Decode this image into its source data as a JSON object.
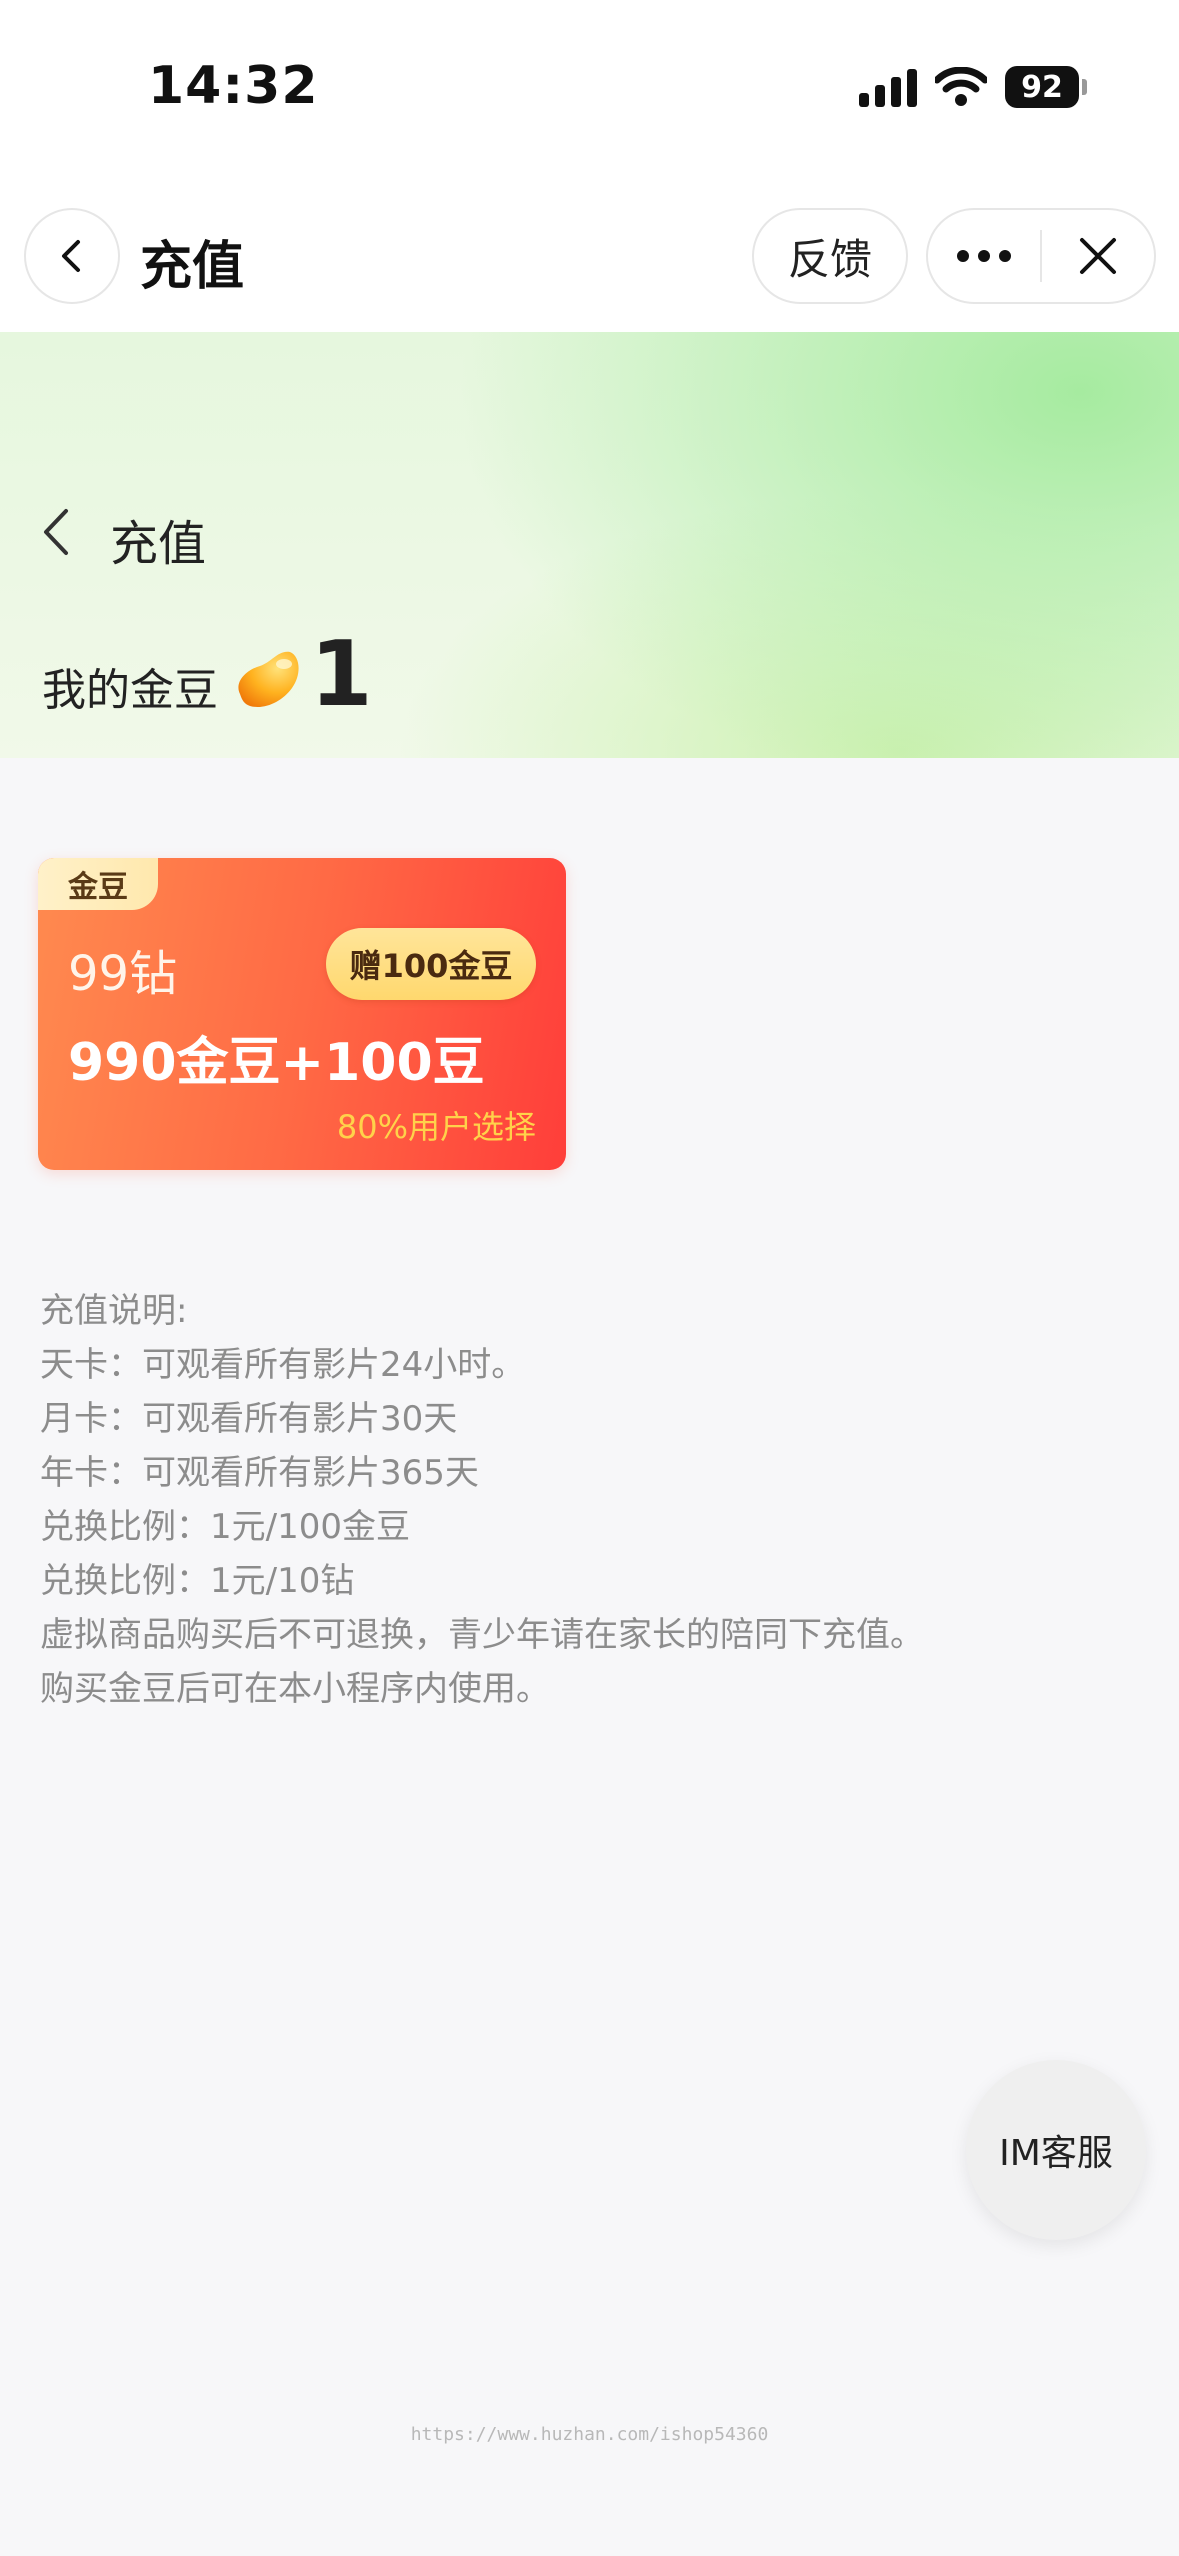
{
  "status_bar": {
    "time": "14:32",
    "battery": "92"
  },
  "nav": {
    "title": "充值",
    "feedback_label": "反馈",
    "icons": [
      "chevron-left-icon",
      "more-icon",
      "close-icon"
    ]
  },
  "hero": {
    "title": "充值",
    "balance_label": "我的金豆",
    "balance_value": "1",
    "colors": {
      "accent": "#a6eba0",
      "background": "#e6f7de"
    }
  },
  "product": {
    "tag": "金豆",
    "price": "99钻",
    "gift": "赠100金豆",
    "amount": "990金豆+100豆",
    "hint": "80%用户选择",
    "colors": {
      "start": "#ff8a4f",
      "end": "#ff3e3a",
      "hint": "#ffd24a"
    }
  },
  "notes": [
    "充值说明:",
    "天卡：可观看所有影片24小时。",
    "月卡：可观看所有影片30天",
    "年卡：可观看所有影片365天",
    "兑换比例：1元/100金豆",
    "兑换比例：1元/10钻",
    "虚拟商品购买后不可退换，青少年请在家长的陪同下充值。",
    "购买金豆后可在本小程序内使用。"
  ],
  "service_button": "IM客服",
  "watermark": "https://www.huzhan.com/ishop54360"
}
